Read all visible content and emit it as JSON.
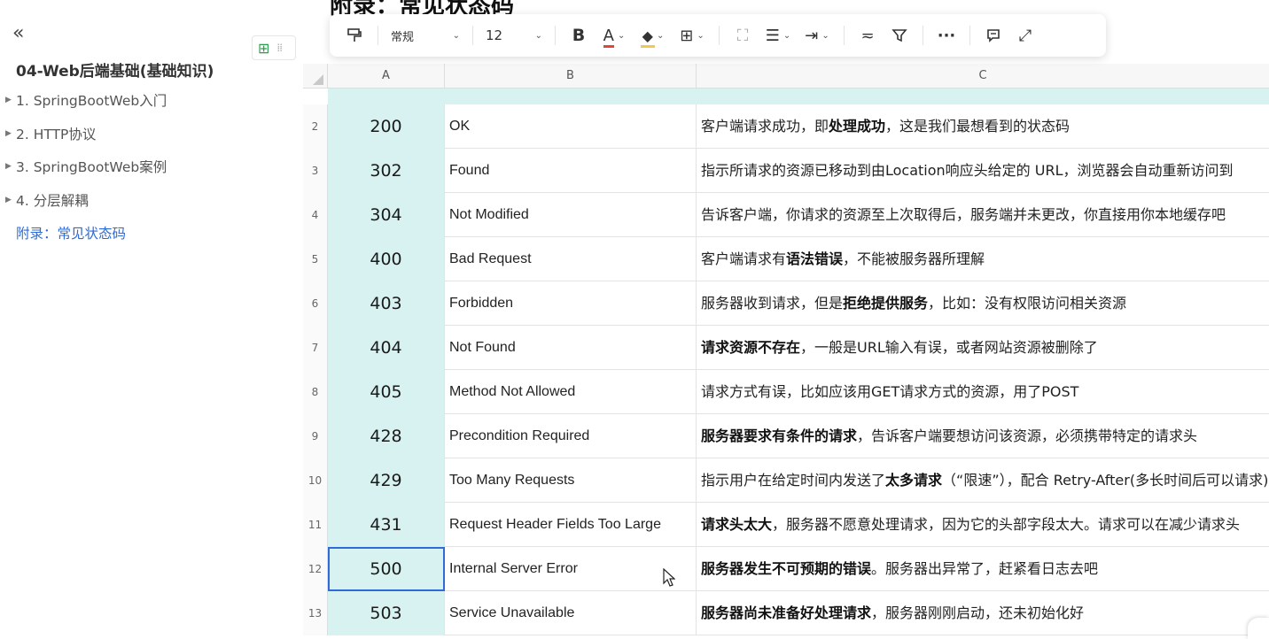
{
  "sidebar": {
    "collapse_icon": "«",
    "doc_title": "04-Web后端基础(基础知识)",
    "items": [
      {
        "label": "1. SpringBootWeb入门",
        "expandable": true
      },
      {
        "label": "2. HTTP协议",
        "expandable": true
      },
      {
        "label": "3. SpringBootWeb案例",
        "expandable": true
      },
      {
        "label": "4. 分层解耦",
        "expandable": true
      },
      {
        "label": "附录：常见状态码",
        "expandable": false,
        "active": true
      }
    ]
  },
  "heading": "附录：常见状态码",
  "toolbar": {
    "style_value": "常规",
    "font_size_value": "12",
    "bold_label": "B",
    "font_color_label": "A",
    "more_label": "···"
  },
  "sheet": {
    "columns": [
      "A",
      "B",
      "C"
    ],
    "rows": [
      {
        "num": "2",
        "code": "200",
        "phrase": "OK",
        "desc_parts": [
          [
            "客户端请求成功，即",
            false
          ],
          [
            "处理成功",
            true
          ],
          [
            "，这是我们最想看到的状态码",
            false
          ]
        ]
      },
      {
        "num": "3",
        "code": "302",
        "phrase": "Found",
        "desc_parts": [
          [
            "指示所请求的资源已移动到由Location响应头给定的 URL，浏览器会自动重新访问到",
            false
          ]
        ]
      },
      {
        "num": "4",
        "code": "304",
        "phrase": "Not Modified",
        "desc_parts": [
          [
            "告诉客户端，你请求的资源至上次取得后，服务端并未更改，你直接用你本地缓存吧",
            false
          ]
        ]
      },
      {
        "num": "5",
        "code": "400",
        "phrase": "Bad Request",
        "desc_parts": [
          [
            "客户端请求有",
            false
          ],
          [
            "语法错误",
            true
          ],
          [
            "，不能被服务器所理解",
            false
          ]
        ]
      },
      {
        "num": "6",
        "code": "403",
        "phrase": "Forbidden",
        "desc_parts": [
          [
            "服务器收到请求，但是",
            false
          ],
          [
            "拒绝提供服务",
            true
          ],
          [
            "，比如：没有权限访问相关资源",
            false
          ]
        ]
      },
      {
        "num": "7",
        "code": "404",
        "phrase": "Not Found",
        "desc_parts": [
          [
            "请求资源不存在",
            true
          ],
          [
            "，一般是URL输入有误，或者网站资源被删除了",
            false
          ]
        ]
      },
      {
        "num": "8",
        "code": "405",
        "phrase": "Method Not Allowed",
        "desc_parts": [
          [
            "请求方式有误，比如应该用GET请求方式的资源，用了POST",
            false
          ]
        ]
      },
      {
        "num": "9",
        "code": "428",
        "phrase": "Precondition Required",
        "desc_parts": [
          [
            "服务器要求有条件的请求",
            true
          ],
          [
            "，告诉客户端要想访问该资源，必须携带特定的请求头",
            false
          ]
        ]
      },
      {
        "num": "10",
        "code": "429",
        "phrase": "Too Many Requests",
        "desc_parts": [
          [
            "指示用户在给定时间内发送了",
            false
          ],
          [
            "太多请求",
            true
          ],
          [
            "（“限速”），配合 Retry-After(多长时间后可以请求)",
            false
          ]
        ]
      },
      {
        "num": "11",
        "code": "431",
        "phrase": "Request Header Fields Too Large",
        "desc_parts": [
          [
            "请求头太大",
            true
          ],
          [
            "，服务器不愿意处理请求，因为它的头部字段太大。请求可以在减少请求头",
            false
          ]
        ]
      },
      {
        "num": "12",
        "code": "500",
        "phrase": "Internal Server Error",
        "desc_parts": [
          [
            "服务器发生不可预期的错误",
            true
          ],
          [
            "。服务器出异常了，赶紧看日志去吧",
            false
          ]
        ],
        "selected": true
      },
      {
        "num": "13",
        "code": "503",
        "phrase": "Service Unavailable",
        "desc_parts": [
          [
            "服务器尚未准备好处理请求",
            true
          ],
          [
            "，服务器刚刚启动，还未初始化好",
            false
          ]
        ]
      }
    ]
  }
}
